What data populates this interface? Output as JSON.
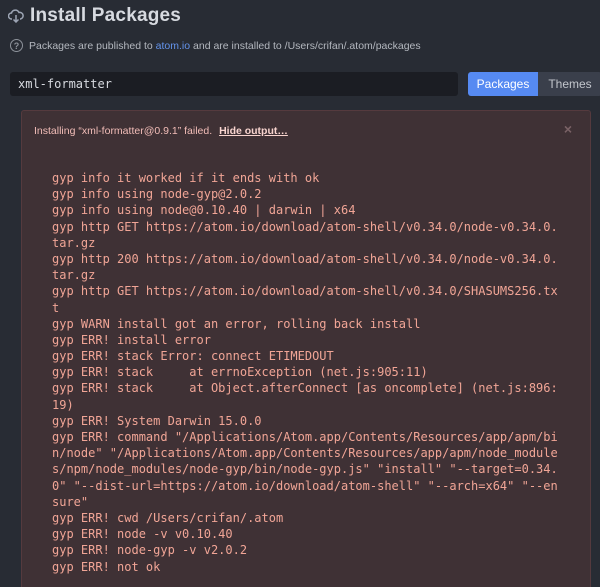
{
  "header": {
    "title": "Install Packages",
    "icon": "cloud-download-icon"
  },
  "info": {
    "icon": "question-icon",
    "prefix": "Packages are published to ",
    "link": "atom.io",
    "suffix": " and are installed to /Users/crifan/.atom/packages"
  },
  "search": {
    "value": "xml-formatter"
  },
  "toggle": {
    "packages_label": "Packages",
    "themes_label": "Themes",
    "active": "Packages"
  },
  "error": {
    "message": "Installing “xml-formatter@0.9.1” failed.",
    "hide_label": "Hide output…",
    "close_glyph": "×",
    "colors": {
      "panel_bg": "#3f3135",
      "text": "#f1a596"
    },
    "lines": [
      "gyp info it worked if it ends with ok",
      "gyp info using node-gyp@2.0.2",
      "gyp info using node@0.10.40 | darwin | x64",
      "gyp http GET https://atom.io/download/atom-shell/v0.34.0/node-v0.34.0.",
      "tar.gz",
      "gyp http 200 https://atom.io/download/atom-shell/v0.34.0/node-v0.34.0.",
      "tar.gz",
      "gyp http GET https://atom.io/download/atom-shell/v0.34.0/SHASUMS256.tx",
      "t",
      "gyp WARN install got an error, rolling back install",
      "gyp ERR! install error",
      "gyp ERR! stack Error: connect ETIMEDOUT",
      "gyp ERR! stack     at errnoException (net.js:905:11)",
      "gyp ERR! stack     at Object.afterConnect [as oncomplete] (net.js:896:",
      "19)",
      "gyp ERR! System Darwin 15.0.0",
      "gyp ERR! command \"/Applications/Atom.app/Contents/Resources/app/apm/bi",
      "n/node\" \"/Applications/Atom.app/Contents/Resources/app/apm/node_module",
      "s/npm/node_modules/node-gyp/bin/node-gyp.js\" \"install\" \"--target=0.34.",
      "0\" \"--dist-url=https://atom.io/download/atom-shell\" \"--arch=x64\" \"--en",
      "sure\"",
      "gyp ERR! cwd /Users/crifan/.atom",
      "gyp ERR! node -v v0.10.40",
      "gyp ERR! node-gyp -v v2.0.2",
      "gyp ERR! not ok"
    ]
  }
}
